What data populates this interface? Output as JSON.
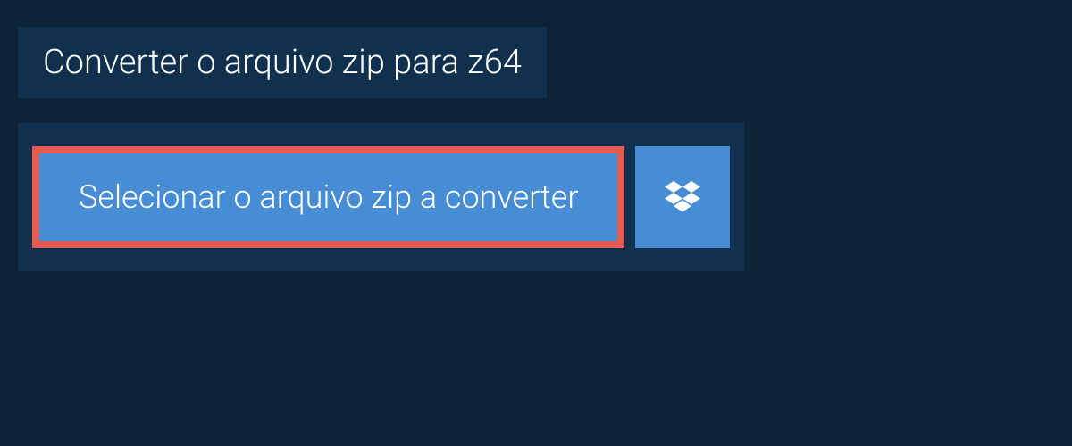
{
  "title": "Converter o arquivo zip para z64",
  "select_button_label": "Selecionar o arquivo zip a converter"
}
